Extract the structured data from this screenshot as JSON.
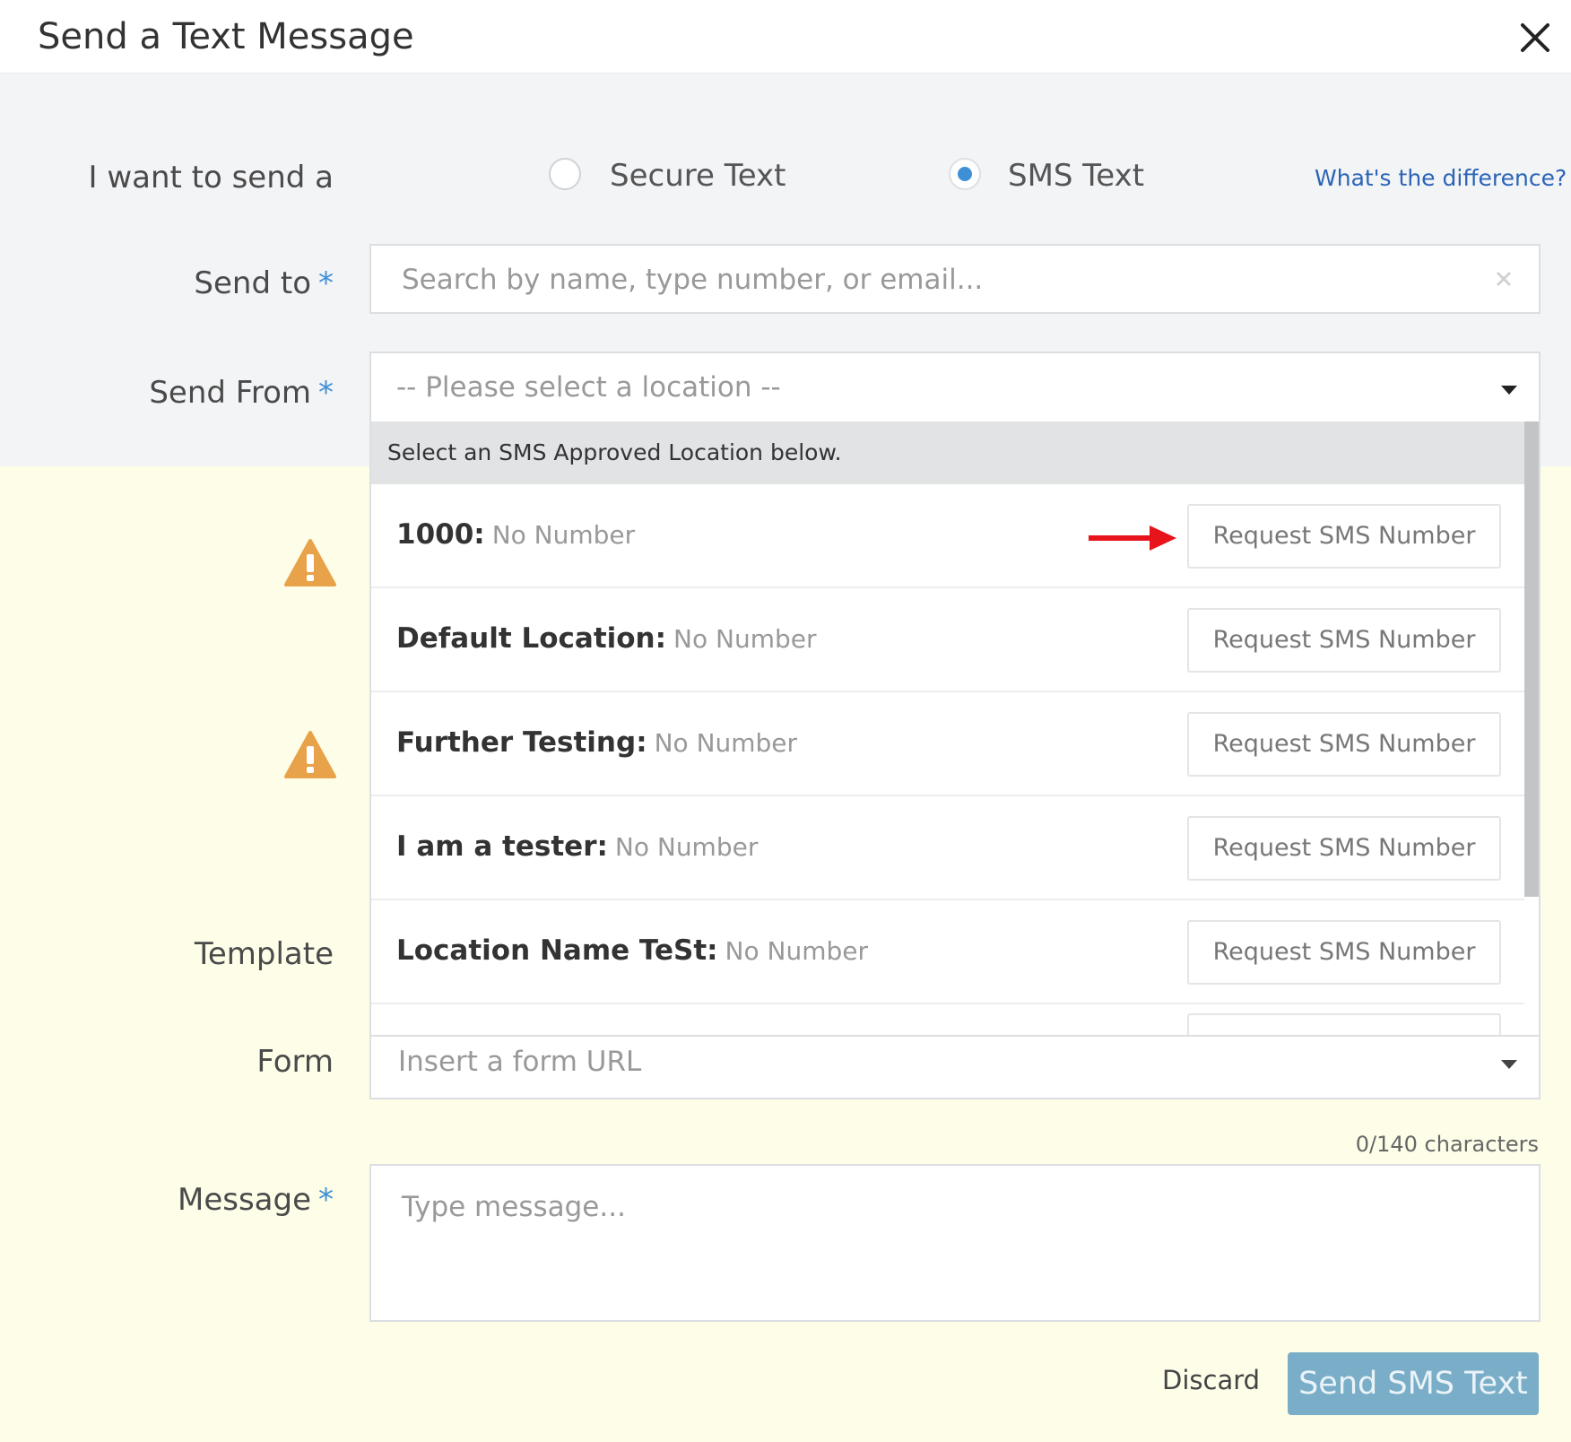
{
  "dialog": {
    "title": "Send a Text Message"
  },
  "send_type": {
    "label": "I want to send a",
    "options": [
      "Secure Text",
      "SMS Text"
    ],
    "selected": "SMS Text",
    "help_link": "What's the difference?"
  },
  "send_to": {
    "label": "Send to",
    "required_mark": "*",
    "placeholder": "Search by name, type number, or email..."
  },
  "send_from": {
    "label": "Send From",
    "required_mark": "*",
    "placeholder": "-- Please select a location --",
    "dropdown_hint": "Select an SMS Approved Location below.",
    "locations": [
      {
        "name": "1000:",
        "number": "No Number",
        "action": "Request SMS Number"
      },
      {
        "name": "Default Location:",
        "number": "No Number",
        "action": "Request SMS Number"
      },
      {
        "name": "Further Testing:",
        "number": "No Number",
        "action": "Request SMS Number"
      },
      {
        "name": "I am a tester:",
        "number": "No Number",
        "action": "Request SMS Number"
      },
      {
        "name": "Location Name TeSt:",
        "number": "No Number",
        "action": "Request SMS Number"
      }
    ]
  },
  "template": {
    "label": "Template"
  },
  "form": {
    "label": "Form",
    "placeholder": "Insert a form URL"
  },
  "message": {
    "label": "Message",
    "required_mark": "*",
    "placeholder": "Type message...",
    "counter": "0/140 characters"
  },
  "footer": {
    "discard": "Discard",
    "send": "Send SMS Text"
  },
  "colors": {
    "accent": "#3f8fd6",
    "link": "#2b64b6",
    "warning": "#e8a24a",
    "annotation_arrow": "#e8141c",
    "send_button": "#7aaec8",
    "highlight_background": "#fdfde8"
  }
}
